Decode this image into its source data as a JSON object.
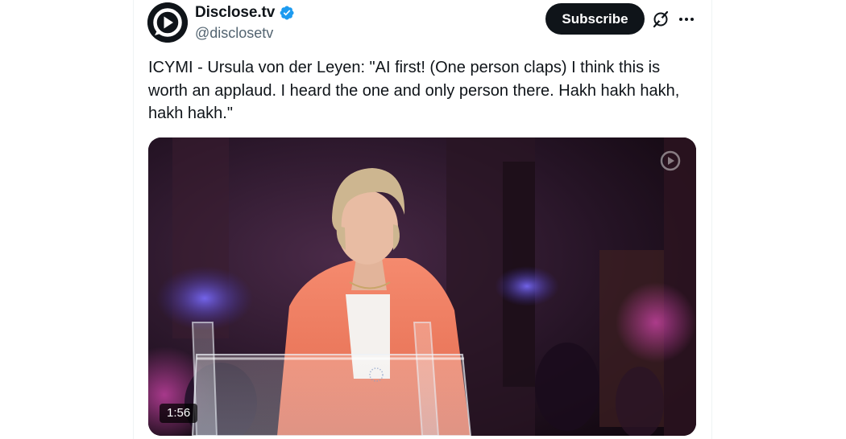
{
  "author": {
    "name": "Disclose.tv",
    "handle": "@disclosetv",
    "verified": true,
    "avatar_icon": "play-logo-icon"
  },
  "actions": {
    "subscribe_label": "Subscribe",
    "grok_icon": "grok-icon",
    "more_icon": "more-icon"
  },
  "tweet": {
    "text": "ICYMI - Ursula von der Leyen: \"AI first! (One person claps) I think this is worth an applaud. I heard the one and only person there. Hakh hakh hakh, hakh hakh.\""
  },
  "media": {
    "type": "video",
    "duration": "1:56",
    "watermark_icon": "play-logo-icon"
  },
  "colors": {
    "text_primary": "#0f1419",
    "text_secondary": "#536471",
    "verified": "#1d9bf0",
    "button_bg": "#0f1419"
  }
}
